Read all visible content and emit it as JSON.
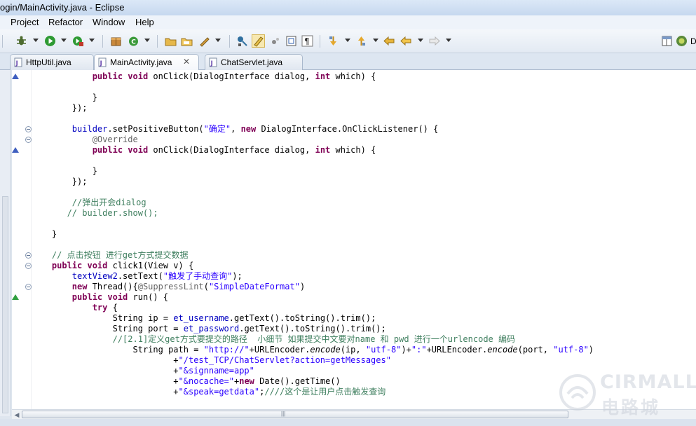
{
  "window": {
    "title": "ogin/MainActivity.java - Eclipse"
  },
  "menu": {
    "items": [
      "Project",
      "Refactor",
      "Window",
      "Help"
    ]
  },
  "toolbar": {
    "perspective_label": "D"
  },
  "tabs": [
    {
      "label": "HttpUtil.java",
      "active": false,
      "closable": false
    },
    {
      "label": "MainActivity.java",
      "active": true,
      "closable": true
    },
    {
      "label": "ChatServlet.java",
      "active": false,
      "closable": false
    }
  ],
  "editor": {
    "lines": [
      "            public void onClick(DialogInterface dialog, int which) {",
      "",
      "            }",
      "        });",
      "",
      "        builder.setPositiveButton(\"确定\", new DialogInterface.OnClickListener() {",
      "            @Override",
      "            public void onClick(DialogInterface dialog, int which) {",
      "",
      "            }",
      "        });",
      "",
      "        //弹出开会dialog",
      "       // builder.show();",
      "",
      "    }",
      "",
      "    // 点击按钮 进行get方式提交数据",
      "    public void click1(View v) {",
      "        textView2.setText(\"触发了手动查询\");",
      "        new Thread(){@SuppressLint(\"SimpleDateFormat\")",
      "        public void run() {",
      "            try {",
      "                String ip = et_username.getText().toString().trim();",
      "                String port = et_password.getText().toString().trim();",
      "                //[2.1]定义get方式要提交的路径  小细节 如果提交中文要对name 和 pwd 进行一个urlencode 编码",
      "                    String path = \"http://\"+URLEncoder.encode(ip, \"utf-8\")+\":\"+URLEncoder.encode(port, \"utf-8\")",
      "                            +\"/test_TCP/ChatServlet?action=getMessages\"",
      "                            +\"&signname=app\"",
      "                            +\"&nocache=\"+new Date().getTime()",
      "                            +\"&speak=getdata\";////这个是让用户点击触发查询"
    ]
  },
  "watermark": {
    "brand": "CIRMALL",
    "sub": "电路城"
  }
}
